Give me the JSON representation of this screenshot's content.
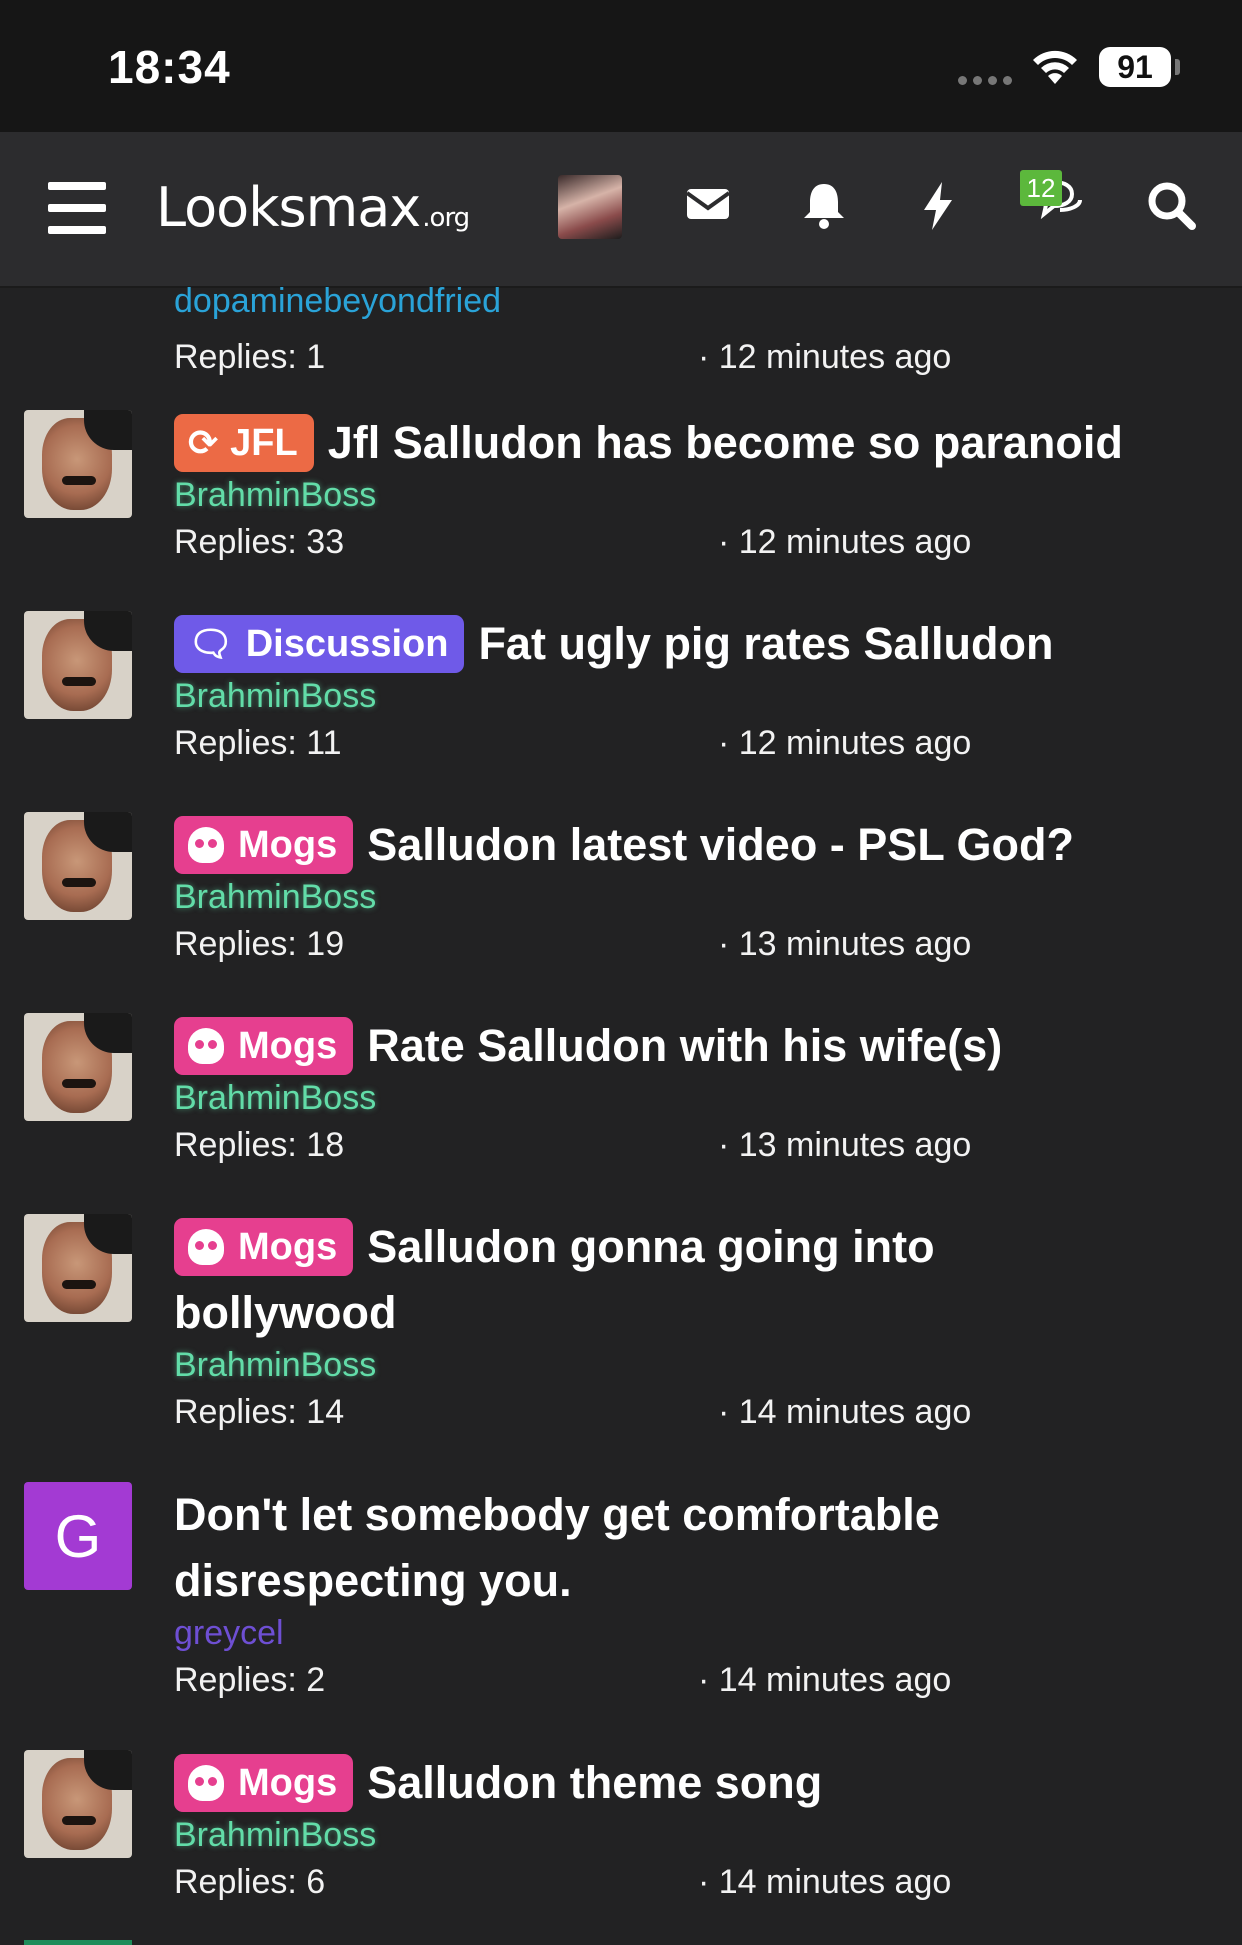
{
  "status_bar": {
    "time": "18:34",
    "battery": "91"
  },
  "navbar": {
    "logo_main": "Looksmax",
    "logo_suffix": ".org",
    "conversations_badge": "12"
  },
  "top_partial": {
    "author": "dopaminebeyondfried",
    "replies": "Replies: 1",
    "time": "· 12 minutes ago"
  },
  "threads": [
    {
      "prefix": "JFL",
      "title": "Jfl Salludon has become so paranoid",
      "author": "BrahminBoss",
      "replies": "Replies: 33",
      "time": "· 12 minutes ago"
    },
    {
      "prefix": "Discussion",
      "title": "Fat ugly pig rates Salludon",
      "author": "BrahminBoss",
      "replies": "Replies: 11",
      "time": "· 12 minutes ago"
    },
    {
      "prefix": "Mogs",
      "title": "Salludon latest video - PSL God?",
      "author": "BrahminBoss",
      "replies": "Replies: 19",
      "time": "· 13 minutes ago"
    },
    {
      "prefix": "Mogs",
      "title": "Rate Salludon with his wife(s)",
      "author": "BrahminBoss",
      "replies": "Replies: 18",
      "time": "· 13 minutes ago"
    },
    {
      "prefix": "Mogs",
      "title": "Salludon gonna going into bollywood",
      "author": "BrahminBoss",
      "replies": "Replies: 14",
      "time": "· 14 minutes ago"
    },
    {
      "prefix": "",
      "avatar_letter": "G",
      "title": "Don't let somebody get comfortable disrespecting you.",
      "author": "greycel",
      "replies": "Replies: 2",
      "time": "· 14 minutes ago"
    },
    {
      "prefix": "Mogs",
      "title": "Salludon theme song",
      "author": "BrahminBoss",
      "replies": "Replies: 6",
      "time": "· 14 minutes ago"
    }
  ]
}
